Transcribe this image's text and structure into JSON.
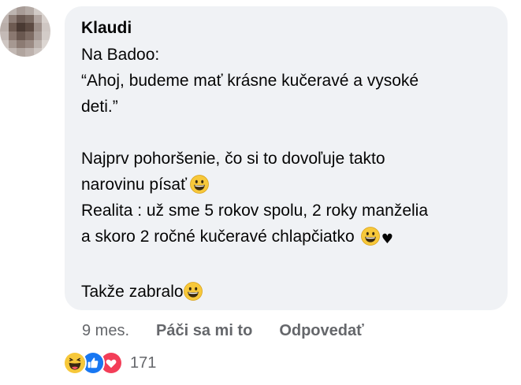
{
  "comment": {
    "author": "Klaudi",
    "lines": [
      "Na Badoo:",
      "“Ahoj, budeme mať krásne kučeravé a vysoké",
      "deti.”",
      "",
      "Najprv pohoršenie, čo si to dovoľuje takto",
      "narovinu písať",
      "Realita : už sme 5 rokov spolu, 2 roky manželia",
      "a skoro 2 ročné kučeravé chlapčiatko",
      "",
      "Takže zabralo"
    ],
    "heart_glyph": "♥"
  },
  "actions": {
    "time": "9 mes.",
    "like_label": "Páči sa mi to",
    "reply_label": "Odpovedať"
  },
  "reactions": {
    "icons": [
      "haha-icon",
      "like-icon",
      "love-icon"
    ],
    "count": "171"
  },
  "colors": {
    "bubble": "#f0f2f5",
    "secondary_text": "#65676b",
    "like_blue": "#1877f2",
    "love_red": "#f33e58",
    "emoji_yellow": "#f7c83a"
  }
}
